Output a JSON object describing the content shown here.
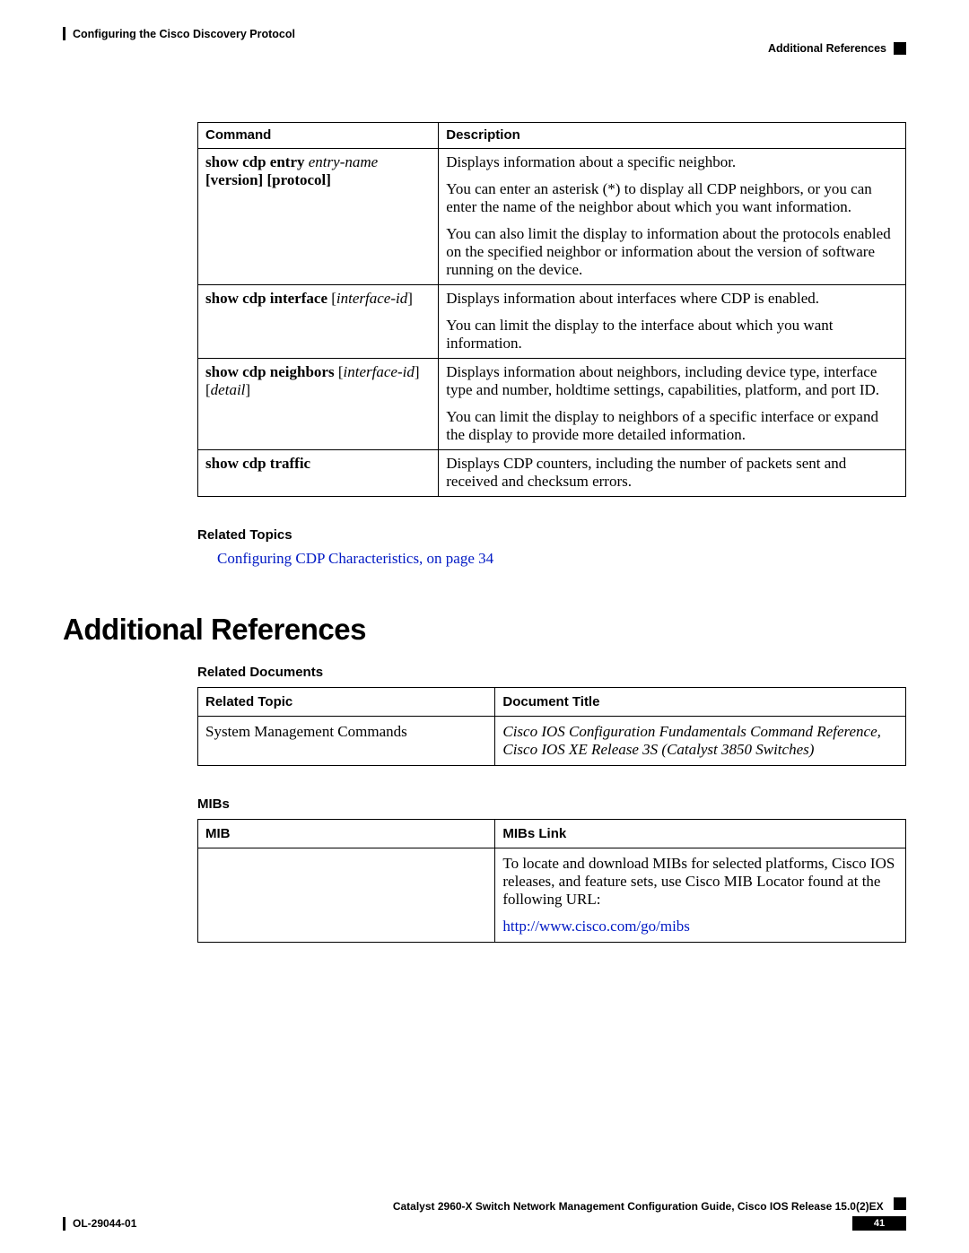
{
  "header": {
    "chapter": "Configuring the Cisco Discovery Protocol",
    "section": "Additional References"
  },
  "cmd_table": {
    "headers": {
      "command": "Command",
      "description": "Description"
    },
    "rows": [
      {
        "cmd_parts": {
          "name": "show cdp entry",
          "arg": "entry-name",
          "opt1": "[version]",
          "opt2": "[protocol]"
        },
        "desc": [
          "Displays information about a specific neighbor.",
          "You can enter an asterisk (*) to display all CDP neighbors, or you can enter the name of the neighbor about which you want information.",
          "You can also limit the display to information about the protocols enabled on the specified neighbor or information about the version of software running on the device."
        ]
      },
      {
        "cmd_parts": {
          "name": "show cdp interface",
          "arg_br": "[interface-id]"
        },
        "desc": [
          "Displays information about interfaces where CDP is enabled.",
          "You can limit the display to the interface about which you want information."
        ]
      },
      {
        "cmd_parts": {
          "name": "show cdp neighbors",
          "arg_br": "[interface-id]",
          "arg_br2": "[detail]"
        },
        "desc": [
          "Displays information about neighbors, including device type, interface type and number, holdtime settings, capabilities, platform, and port ID.",
          "You can limit the display to neighbors of a specific interface or expand the display to provide more detailed information."
        ]
      },
      {
        "cmd_parts": {
          "name": "show cdp traffic"
        },
        "desc": [
          "Displays CDP counters, including the number of packets sent and received and checksum errors."
        ]
      }
    ]
  },
  "related_topics": {
    "heading": "Related Topics",
    "link": "Configuring CDP Characteristics,  on page 34"
  },
  "section_title": "Additional References",
  "related_docs": {
    "heading": "Related Documents",
    "headers": {
      "topic": "Related Topic",
      "title": "Document Title"
    },
    "row": {
      "topic": "System Management Commands",
      "title": "Cisco IOS Configuration Fundamentals Command Reference, Cisco IOS XE Release 3S (Catalyst 3850 Switches)"
    }
  },
  "mibs": {
    "heading": "MIBs",
    "headers": {
      "mib": "MIB",
      "link": "MIBs Link"
    },
    "row": {
      "text": "To locate and download MIBs for selected platforms, Cisco IOS releases, and feature sets, use Cisco MIB Locator found at the following URL:",
      "url": "http://www.cisco.com/go/mibs"
    }
  },
  "footer": {
    "guide": "Catalyst 2960-X Switch Network Management Configuration Guide, Cisco IOS Release 15.0(2)EX",
    "ol": "OL-29044-01",
    "page": "41"
  }
}
